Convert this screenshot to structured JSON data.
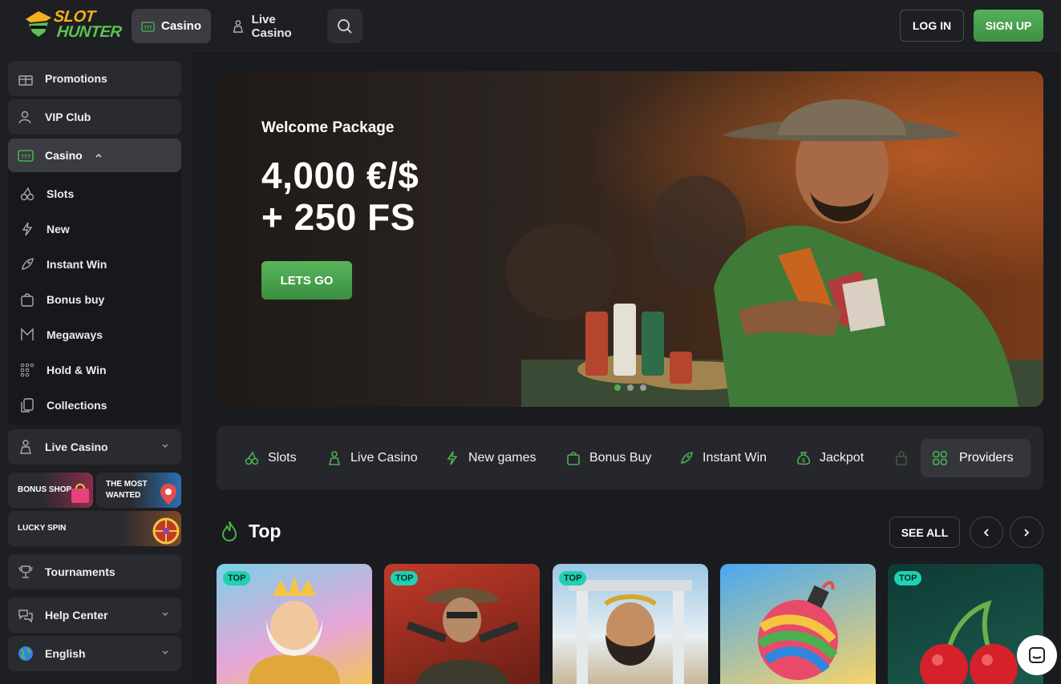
{
  "brand": {
    "logo_line1": "SLOT",
    "logo_line2": "HUNTER"
  },
  "topnav": {
    "casino": "Casino",
    "live_casino": "Live Casino",
    "login": "LOG IN",
    "signup": "SIGN UP"
  },
  "sidebar": {
    "promotions": "Promotions",
    "vip": "VIP Club",
    "casino": "Casino",
    "casino_items": [
      "Slots",
      "New",
      "Instant Win",
      "Bonus buy",
      "Megaways",
      "Hold & Win",
      "Collections"
    ],
    "live_casino": "Live Casino",
    "bonus_shop": "BONUS SHOP",
    "most_wanted_1": "THE MOST",
    "most_wanted_2": "WANTED",
    "lucky_spin": "LUCKY SPIN",
    "tournaments": "Tournaments",
    "help": "Help Center",
    "language": "English"
  },
  "hero": {
    "title": "Welcome Package",
    "line1": "4,000 €/$",
    "line2": "+ 250 FS",
    "cta": "LETS GO",
    "active_slide": 1,
    "slides": 3
  },
  "categories": [
    "Slots",
    "Live Casino",
    "New games",
    "Bonus Buy",
    "Instant Win",
    "Jackpot"
  ],
  "providers": "Providers",
  "section": {
    "title": "Top",
    "see_all": "SEE ALL"
  },
  "cards": [
    {
      "badge": "TOP"
    },
    {
      "badge": "TOP"
    },
    {
      "badge": "TOP"
    },
    {
      "badge": ""
    },
    {
      "badge": "TOP"
    }
  ],
  "colors": {
    "accent_green": "#4caf50",
    "badge_teal": "#1fd1b0",
    "logo_gold": "#f4b11c"
  }
}
